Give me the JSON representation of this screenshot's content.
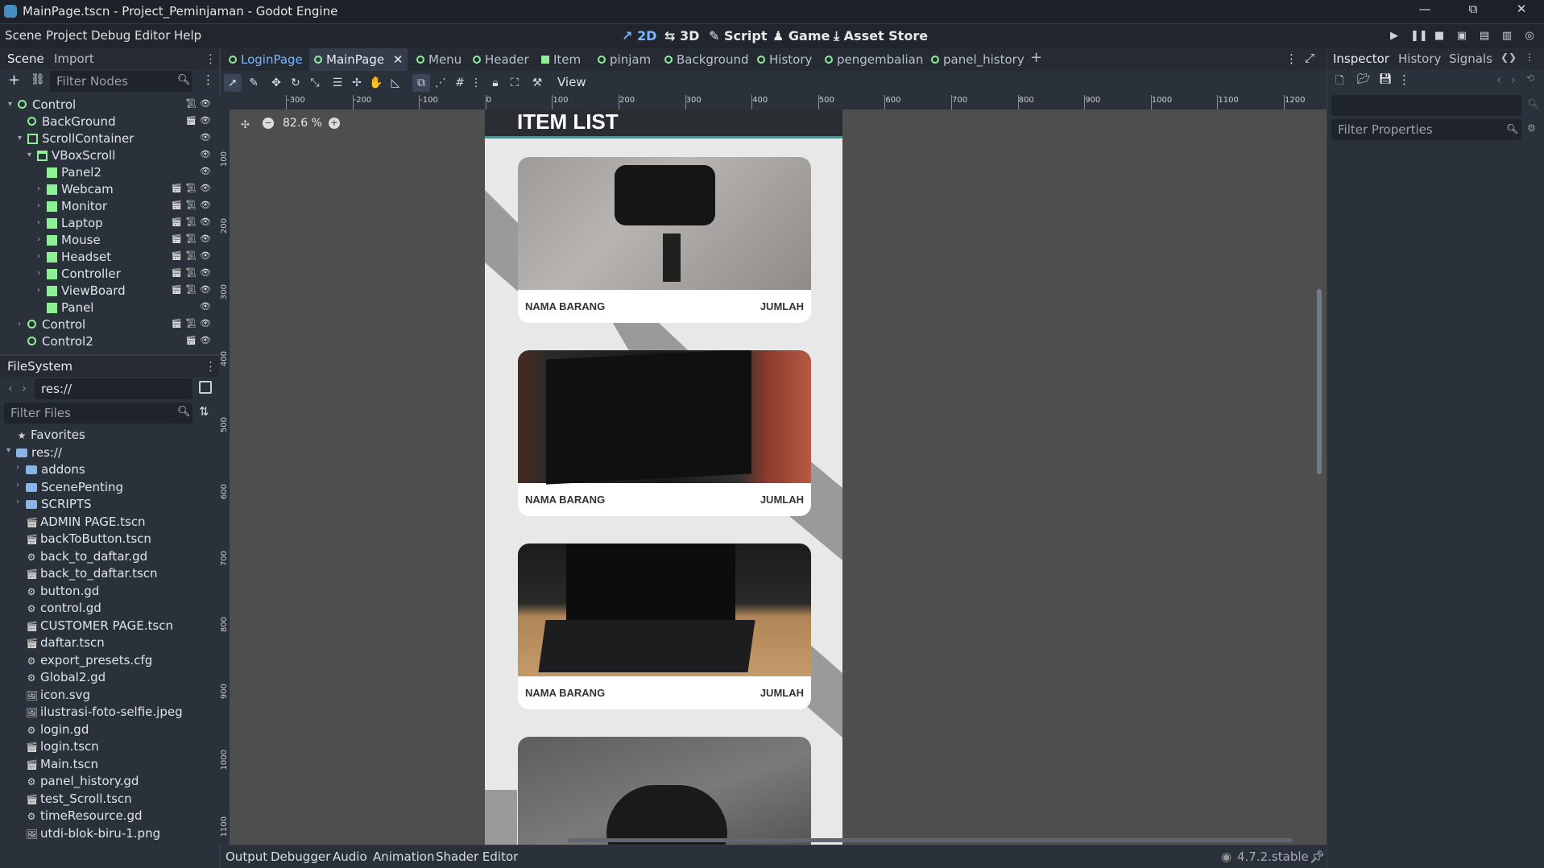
{
  "window": {
    "title": "MainPage.tscn - Project_Peminjaman - Godot Engine",
    "minimize": "—",
    "maximize": "⧉",
    "close": "✕"
  },
  "menu": [
    "Scene",
    "Project",
    "Debug",
    "Editor",
    "Help"
  ],
  "workspaces": [
    {
      "icon": "↗",
      "label": "2D",
      "active": true
    },
    {
      "icon": "⇆",
      "label": "3D"
    },
    {
      "icon": "✎",
      "label": "Script"
    },
    {
      "icon": "♟",
      "label": "Game"
    },
    {
      "icon": "⤓",
      "label": "Asset Store"
    }
  ],
  "scene_dock": {
    "tabs": [
      "Scene",
      "Import"
    ],
    "filter_placeholder": "Filter Nodes",
    "nodes": [
      {
        "label": "Control",
        "icon": "circle",
        "indent": 0,
        "arrow": "▾"
      },
      {
        "label": "BackGround",
        "icon": "circle",
        "indent": 1
      },
      {
        "label": "ScrollContainer",
        "icon": "scroll",
        "indent": 1,
        "arrow": "▾"
      },
      {
        "label": "VBoxScroll",
        "icon": "vbox",
        "indent": 2,
        "arrow": "▾"
      },
      {
        "label": "Panel2",
        "icon": "square",
        "indent": 3
      },
      {
        "label": "Webcam",
        "icon": "square",
        "indent": 3,
        "arrow": "›"
      },
      {
        "label": "Monitor",
        "icon": "square",
        "indent": 3,
        "arrow": "›"
      },
      {
        "label": "Laptop",
        "icon": "square",
        "indent": 3,
        "arrow": "›"
      },
      {
        "label": "Mouse",
        "icon": "square",
        "indent": 3,
        "arrow": "›"
      },
      {
        "label": "Headset",
        "icon": "square",
        "indent": 3,
        "arrow": "›"
      },
      {
        "label": "Controller",
        "icon": "square",
        "indent": 3,
        "arrow": "›"
      },
      {
        "label": "ViewBoard",
        "icon": "square",
        "indent": 3,
        "arrow": "›"
      },
      {
        "label": "Panel",
        "icon": "square",
        "indent": 3
      },
      {
        "label": "Control",
        "icon": "circle",
        "indent": 1,
        "arrow": "›"
      },
      {
        "label": "Control2",
        "icon": "circle",
        "indent": 1
      }
    ]
  },
  "filesystem": {
    "tab": "FileSystem",
    "path": "res://",
    "filter_placeholder": "Filter Files",
    "items": [
      {
        "label": "Favorites",
        "type": "star",
        "indent": 0
      },
      {
        "label": "res://",
        "type": "folder",
        "indent": 0,
        "arrow": "▾"
      },
      {
        "label": "addons",
        "type": "folder",
        "indent": 1,
        "arrow": "›"
      },
      {
        "label": "ScenePenting",
        "type": "folder",
        "indent": 1,
        "arrow": "›"
      },
      {
        "label": "SCRIPTS",
        "type": "folder",
        "indent": 1,
        "arrow": "›"
      },
      {
        "label": "ADMIN PAGE.tscn",
        "type": "scene",
        "indent": 1
      },
      {
        "label": "backToButton.tscn",
        "type": "scene",
        "indent": 1
      },
      {
        "label": "back_to_daftar.gd",
        "type": "script",
        "indent": 1
      },
      {
        "label": "back_to_daftar.tscn",
        "type": "scene",
        "indent": 1
      },
      {
        "label": "button.gd",
        "type": "script",
        "indent": 1
      },
      {
        "label": "control.gd",
        "type": "script",
        "indent": 1
      },
      {
        "label": "CUSTOMER PAGE.tscn",
        "type": "scene",
        "indent": 1
      },
      {
        "label": "daftar.tscn",
        "type": "scene",
        "indent": 1
      },
      {
        "label": "export_presets.cfg",
        "type": "script",
        "indent": 1
      },
      {
        "label": "Global2.gd",
        "type": "script",
        "indent": 1
      },
      {
        "label": "icon.svg",
        "type": "image",
        "indent": 1
      },
      {
        "label": "ilustrasi-foto-selfie.jpeg",
        "type": "image",
        "indent": 1
      },
      {
        "label": "login.gd",
        "type": "script",
        "indent": 1
      },
      {
        "label": "login.tscn",
        "type": "scene",
        "indent": 1
      },
      {
        "label": "Main.tscn",
        "type": "scene",
        "indent": 1
      },
      {
        "label": "panel_history.gd",
        "type": "script",
        "indent": 1
      },
      {
        "label": "test_Scroll.tscn",
        "type": "scene",
        "indent": 1
      },
      {
        "label": "timeResource.gd",
        "type": "script",
        "indent": 1
      },
      {
        "label": "utdi-blok-biru-1.png",
        "type": "image",
        "indent": 1
      }
    ]
  },
  "scene_tabs": [
    {
      "label": "LoginPage",
      "color": "#79b6ff"
    },
    {
      "label": "MainPage",
      "active": true
    },
    {
      "label": "Menu"
    },
    {
      "label": "Header"
    },
    {
      "label": "Item",
      "square": true
    },
    {
      "label": "pinjam"
    },
    {
      "label": "Background"
    },
    {
      "label": "History"
    },
    {
      "label": "pengembalian"
    },
    {
      "label": "panel_history"
    }
  ],
  "toolbar": {
    "view_label": "View"
  },
  "zoom": {
    "level": "82.6 %"
  },
  "ruler_h": [
    "-300",
    "-200",
    "-100",
    "0",
    "100",
    "200",
    "300",
    "400",
    "500",
    "600",
    "700",
    "800",
    "900",
    "1000",
    "1100",
    "1200"
  ],
  "ruler_v": [
    "100",
    "200",
    "300",
    "400",
    "500",
    "600",
    "700",
    "800",
    "900",
    "1000",
    "1100"
  ],
  "canvas": {
    "header_title": "ITEM LIST",
    "cards": [
      {
        "name": "NAMA BARANG",
        "qty": "JUMLAH",
        "image": "webcam"
      },
      {
        "name": "NAMA BARANG",
        "qty": "JUMLAH",
        "image": "monitor"
      },
      {
        "name": "NAMA BARANG",
        "qty": "JUMLAH",
        "image": "laptop"
      },
      {
        "name": "",
        "qty": "",
        "image": "mouse"
      }
    ]
  },
  "bottom_panel": {
    "tabs": [
      "Output",
      "Debugger",
      "Audio",
      "Animation",
      "Shader Editor"
    ],
    "version": "4.7.2.stable"
  },
  "inspector": {
    "tabs": [
      "Inspector",
      "History",
      "Signals"
    ],
    "filter_placeholder": "Filter Properties"
  }
}
